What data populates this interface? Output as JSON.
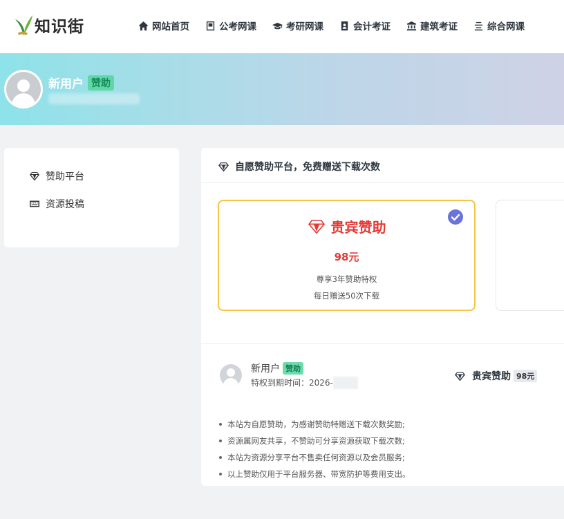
{
  "logo": {
    "text": "知识街"
  },
  "nav": [
    {
      "label": "网站首页",
      "icon": "home-icon"
    },
    {
      "label": "公考网课",
      "icon": "flag-icon"
    },
    {
      "label": "考研网课",
      "icon": "graduation-cap-icon"
    },
    {
      "label": "会计考证",
      "icon": "id-badge-icon"
    },
    {
      "label": "建筑考证",
      "icon": "bank-icon"
    },
    {
      "label": "综合网课",
      "icon": "list-icon"
    }
  ],
  "banner": {
    "username": "新用户",
    "badge": "赞助"
  },
  "sidebar": {
    "items": [
      {
        "label": "赞助平台",
        "icon": "diamond-icon"
      },
      {
        "label": "资源投稿",
        "icon": "keyboard-icon"
      }
    ]
  },
  "main": {
    "title": "自愿赞助平台，免费赠送下载次数",
    "plan": {
      "name": "贵宾赞助",
      "price": "98元",
      "desc1": "尊享3年赞助特权",
      "desc2": "每日赠送50次下载"
    },
    "user": {
      "name": "新用户",
      "badge": "赞助",
      "expire": "特权到期时间：2026-"
    },
    "summary": {
      "name": "贵宾赞助",
      "price": "98元"
    },
    "notes": [
      "本站为自愿赞助，为感谢赞助特赠送下载次数奖励;",
      "资源属网友共享，不赞助可分享资源获取下载次数;",
      "本站为资源分享平台不售卖任何资源以及会员服务;",
      "以上赞助仅用于平台服务器、带宽防护等费用支出。"
    ]
  },
  "colors": {
    "accent": "#e53935",
    "selected_border": "#f5c443",
    "check": "#6a74d8",
    "badge": "#5fd8a8"
  }
}
